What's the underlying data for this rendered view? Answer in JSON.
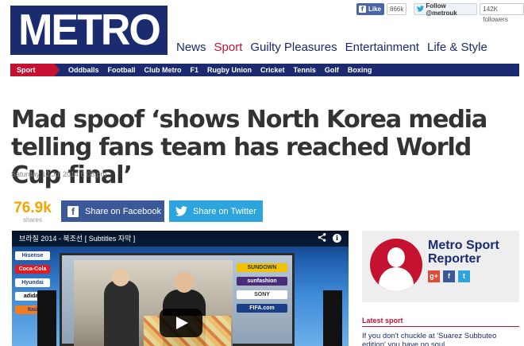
{
  "social": {
    "fb_like_label": "Like",
    "fb_like_count": "866k",
    "twitter_follow_label": "Follow @metrouk",
    "twitter_followers": "142K followers"
  },
  "logo": {
    "text": "METRO"
  },
  "main_nav": [
    {
      "label": "News"
    },
    {
      "label": "Sport",
      "active": true
    },
    {
      "label": "Guilty Pleasures"
    },
    {
      "label": "Entertainment"
    },
    {
      "label": "Life & Style"
    }
  ],
  "sub_nav": {
    "section": "Sport",
    "items": [
      {
        "label": "Oddballs"
      },
      {
        "label": "Football"
      },
      {
        "label": "Club Metro"
      },
      {
        "label": "F1"
      },
      {
        "label": "Rugby Union"
      },
      {
        "label": "Cricket"
      },
      {
        "label": "Tennis"
      },
      {
        "label": "Golf"
      },
      {
        "label": "Boxing"
      }
    ]
  },
  "article": {
    "headline": "Mad spoof ‘shows North Korea media telling fans team has reached World Cup final’",
    "dateline": "Saturday 12 Jul 2014 6:03 pm"
  },
  "shares": {
    "count": "76.9k",
    "label": "shares",
    "facebook_label": "Share on Facebook",
    "twitter_label": "Share on Twitter"
  },
  "video": {
    "title": "브라질 2014 - 북조선 [ Subtitles 자막 ]",
    "sponsors": [
      "SUNDOWN",
      "sunfashion",
      "SONY",
      "FIFA.com"
    ],
    "sponsors_left": [
      "Hisense",
      "Coca-Cola",
      "Hyundai",
      "adidas",
      "Itaú"
    ]
  },
  "author": {
    "name": "Metro Sport Reporter",
    "icons": [
      "g+",
      "f",
      "t"
    ]
  },
  "latest": {
    "header": "Latest sport",
    "items": [
      "If you don't chuckle at 'Suarez Subbuteo edition' you have no soul"
    ]
  },
  "colors": {
    "brand_navy": "#1b2b6f",
    "brand_red": "#c41230",
    "shares_orange": "#f5a400",
    "facebook_blue": "#3b5998",
    "twitter_blue": "#2ca4dd"
  }
}
